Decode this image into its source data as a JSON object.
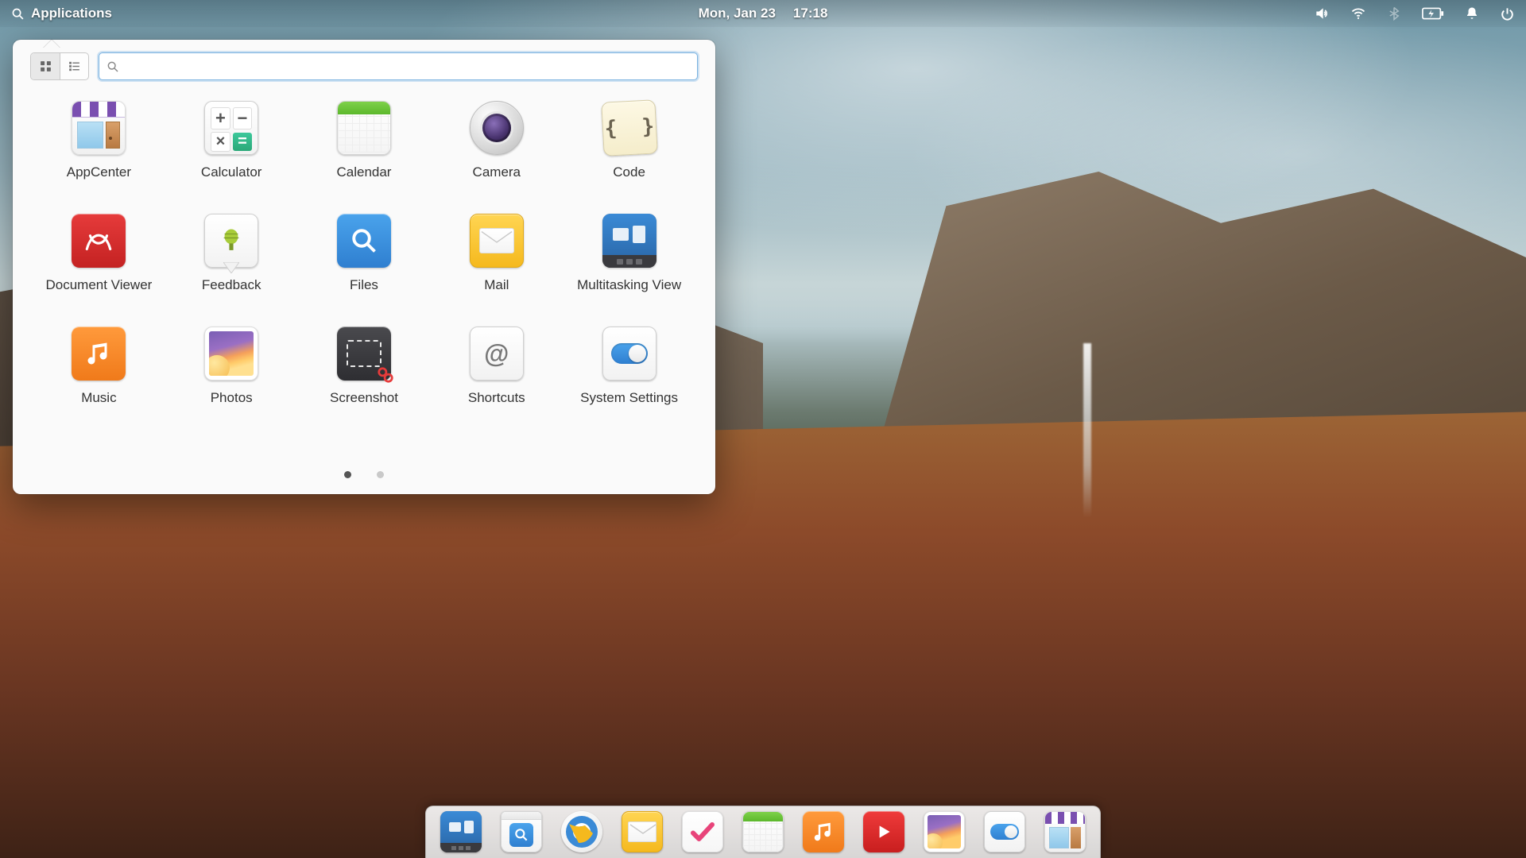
{
  "panel": {
    "applications_label": "Applications",
    "date": "Mon, Jan 23",
    "time": "17:18"
  },
  "launcher": {
    "search_placeholder": "",
    "apps": [
      {
        "label": "AppCenter",
        "id": "appcenter"
      },
      {
        "label": "Calculator",
        "id": "calculator"
      },
      {
        "label": "Calendar",
        "id": "calendar"
      },
      {
        "label": "Camera",
        "id": "camera"
      },
      {
        "label": "Code",
        "id": "code"
      },
      {
        "label": "Document Viewer",
        "id": "document-viewer"
      },
      {
        "label": "Feedback",
        "id": "feedback"
      },
      {
        "label": "Files",
        "id": "files"
      },
      {
        "label": "Mail",
        "id": "mail"
      },
      {
        "label": "Multitasking View",
        "id": "multitasking-view"
      },
      {
        "label": "Music",
        "id": "music"
      },
      {
        "label": "Photos",
        "id": "photos"
      },
      {
        "label": "Screenshot",
        "id": "screenshot"
      },
      {
        "label": "Shortcuts",
        "id": "shortcuts"
      },
      {
        "label": "System Settings",
        "id": "system-settings"
      }
    ],
    "pages": 2,
    "active_page": 0
  },
  "dock": {
    "items": [
      {
        "id": "multitasking-view"
      },
      {
        "id": "files"
      },
      {
        "id": "web-browser"
      },
      {
        "id": "mail"
      },
      {
        "id": "tasks"
      },
      {
        "id": "calendar"
      },
      {
        "id": "music"
      },
      {
        "id": "videos"
      },
      {
        "id": "photos"
      },
      {
        "id": "system-settings"
      },
      {
        "id": "appcenter"
      }
    ]
  }
}
